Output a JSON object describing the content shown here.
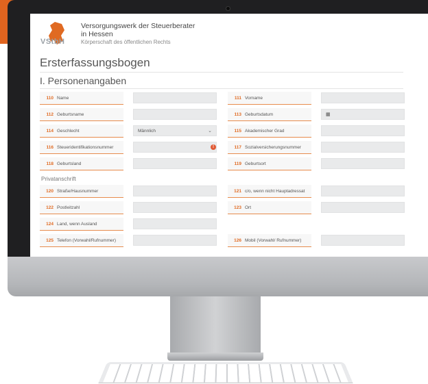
{
  "org": {
    "logo_text": "VStbH",
    "name_line1": "Versorgungswerk der Steuerberater",
    "name_line2": "in Hessen",
    "name_line3": "Körperschaft des öffentlichen Rechts"
  },
  "page_title": "Ersterfassungsbogen",
  "section_title": "I. Personenangaben",
  "subsection_title": "Privatanschrift",
  "fields": [
    {
      "num": "110",
      "label": "Name"
    },
    {
      "num": "111",
      "label": "Vorname"
    },
    {
      "num": "112",
      "label": "Geburtsname"
    },
    {
      "num": "113",
      "label": "Geburtsdatum"
    },
    {
      "num": "114",
      "label": "Geschlecht",
      "value": "Männlich"
    },
    {
      "num": "115",
      "label": "Akademischer Grad"
    },
    {
      "num": "116",
      "label": "Steueridentifikationsnummer"
    },
    {
      "num": "117",
      "label": "Sozialversicherungsnummer"
    },
    {
      "num": "118",
      "label": "Geburtsland"
    },
    {
      "num": "119",
      "label": "Geburtsort"
    },
    {
      "num": "120",
      "label": "Straße/Hausnummer"
    },
    {
      "num": "121",
      "label": "c/o, wenn nicht Hauptadressat"
    },
    {
      "num": "122",
      "label": "Postleitzahl"
    },
    {
      "num": "123",
      "label": "Ort"
    },
    {
      "num": "124",
      "label": "Land, wenn Ausland"
    },
    {
      "num": "125",
      "label": "Telefon (Vorwahl/Rufnummer)"
    },
    {
      "num": "126",
      "label": "Mobil (Vorwahl/ Rufnummer)"
    }
  ],
  "icons": {
    "select_chevron": "chevron-down-icon",
    "warning": "warning-icon",
    "date_picker": "calendar-icon"
  },
  "colors": {
    "accent": "#e06a22",
    "brand_band": "#e8732a",
    "input_bg": "#e9eaeb"
  }
}
